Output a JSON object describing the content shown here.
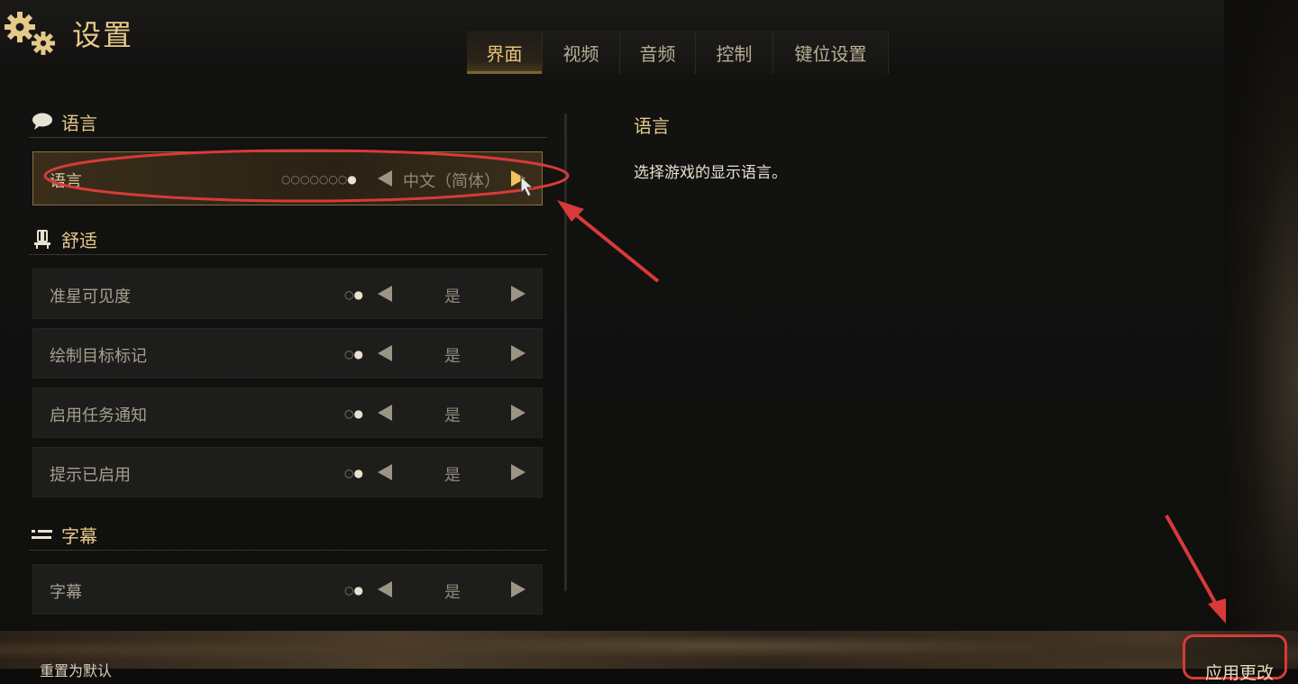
{
  "header": {
    "title": "设置",
    "icon": "gears-icon",
    "tabs": [
      {
        "label": "界面",
        "active": true
      },
      {
        "label": "视频",
        "active": false
      },
      {
        "label": "音频",
        "active": false
      },
      {
        "label": "控制",
        "active": false
      },
      {
        "label": "键位设置",
        "active": false
      }
    ]
  },
  "sections": {
    "language": {
      "title": "语言",
      "icon": "speech-bubble-icon"
    },
    "comfort": {
      "title": "舒适",
      "icon": "seat-icon"
    },
    "subtitles": {
      "title": "字幕",
      "icon": "list-icon"
    }
  },
  "rows": {
    "language": {
      "label": "语言",
      "value": "中文（简体）",
      "dots_off": "○○○○○○○",
      "dots_on": "●"
    },
    "crosshair": {
      "label": "准星可见度",
      "value": "是",
      "dots_off": "○",
      "dots_on": "●"
    },
    "target_marker": {
      "label": "绘制目标标记",
      "value": "是",
      "dots_off": "○",
      "dots_on": "●"
    },
    "task_notify": {
      "label": "启用任务通知",
      "value": "是",
      "dots_off": "○",
      "dots_on": "●"
    },
    "hints": {
      "label": "提示已启用",
      "value": "是",
      "dots_off": "○",
      "dots_on": "●"
    },
    "subtitles": {
      "label": "字幕",
      "value": "是",
      "dots_off": "○",
      "dots_on": "●"
    }
  },
  "description": {
    "title": "语言",
    "text": "选择游戏的显示语言。"
  },
  "footer": {
    "reset_label": "重置为默认",
    "apply_label": "应用更改"
  },
  "colors": {
    "accent_gold": "#e6c98a",
    "annotation_red": "#d83a3a"
  }
}
